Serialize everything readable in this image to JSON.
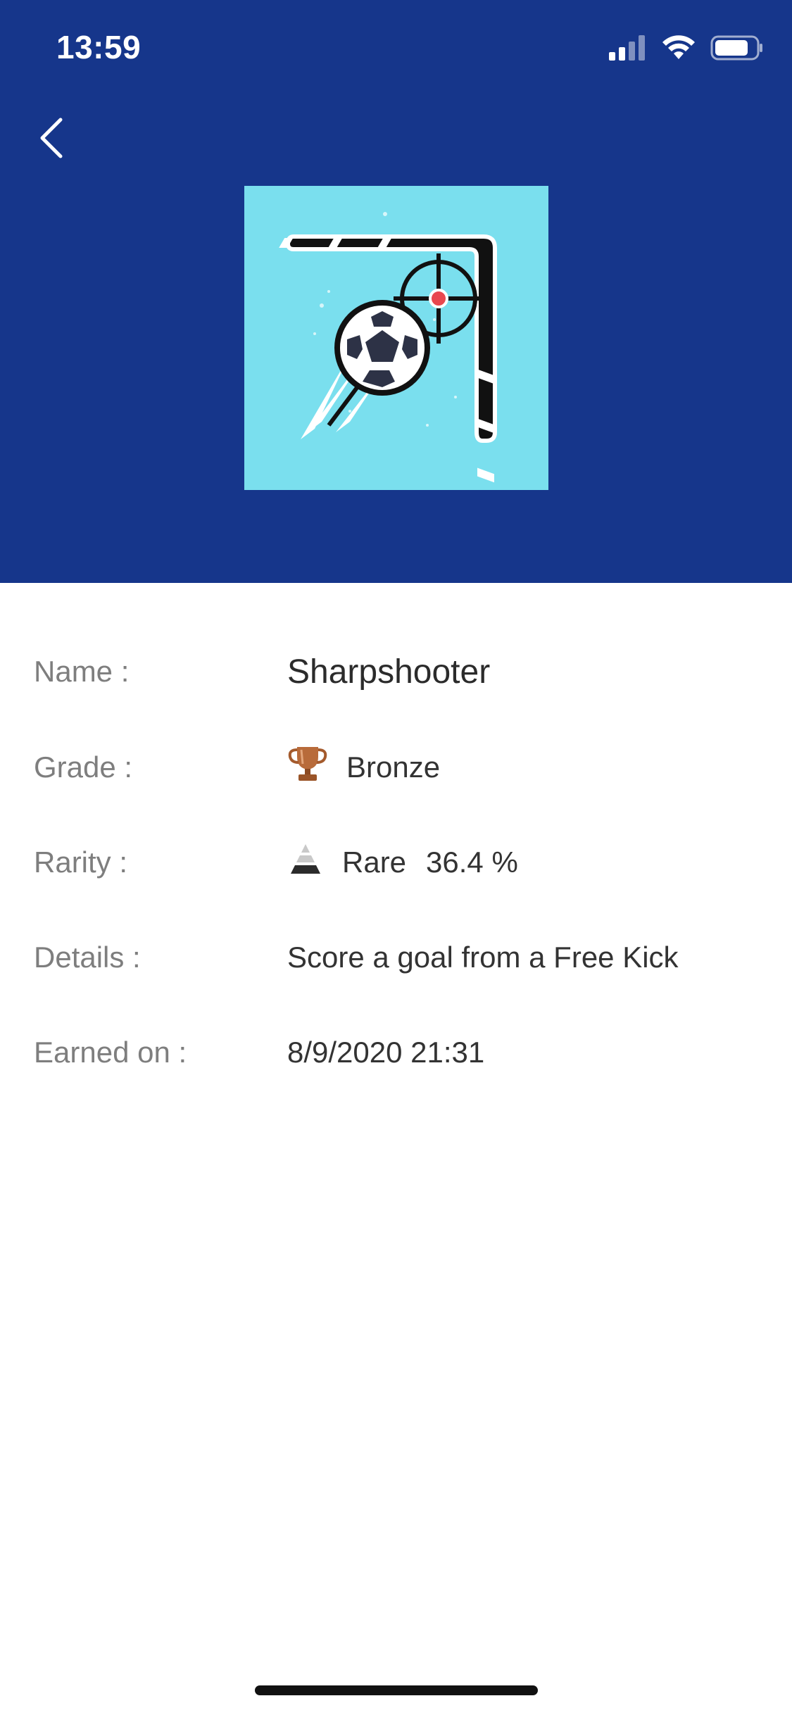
{
  "status_bar": {
    "time": "13:59"
  },
  "header": {
    "background_color": "#16368b",
    "back_icon": "chevron-left-icon",
    "trophy_image_icon": "football-sharpshooter-trophy-art"
  },
  "trophy": {
    "rows": [
      {
        "label": "Name :",
        "value": "Sharpshooter"
      },
      {
        "label": "Grade :",
        "icon": "bronze-trophy-icon",
        "value": "Bronze"
      },
      {
        "label": "Rarity :",
        "icon": "rarity-pyramid-icon",
        "value": "Rare",
        "percent": "36.4 %"
      },
      {
        "label": "Details :",
        "value": "Score a goal from a Free Kick"
      },
      {
        "label": "Earned on :",
        "value": "8/9/2020 21:31"
      }
    ]
  }
}
